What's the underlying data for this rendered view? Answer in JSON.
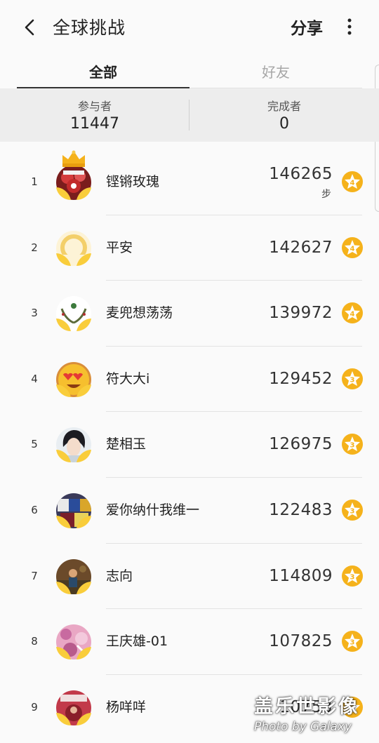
{
  "header": {
    "title": "全球挑战",
    "share_label": "分享"
  },
  "tabs": [
    {
      "label": "全部",
      "active": true
    },
    {
      "label": "好友",
      "active": false
    }
  ],
  "stats": {
    "participants_label": "参与者",
    "participants_value": "11447",
    "finishers_label": "完成者",
    "finishers_value": "0"
  },
  "ranking": [
    {
      "rank": "1",
      "name": "铿锵玫瑰",
      "steps": "146265",
      "unit": "步",
      "badge": "4",
      "avatar": "red-flowers",
      "crown": true
    },
    {
      "rank": "2",
      "name": "平安",
      "steps": "142627",
      "badge": "4",
      "avatar": "placeholder"
    },
    {
      "rank": "3",
      "name": "麦兜想荡荡",
      "steps": "139972",
      "badge": "4",
      "avatar": "wreath"
    },
    {
      "rank": "4",
      "name": "符大大i",
      "steps": "129452",
      "badge": "3",
      "avatar": "heart-eyes-emoji"
    },
    {
      "rank": "5",
      "name": "楚相玉",
      "steps": "126975",
      "badge": "3",
      "avatar": "anime-boy"
    },
    {
      "rank": "6",
      "name": "爱你纳什我维一",
      "steps": "122483",
      "badge": "3",
      "avatar": "jerseys"
    },
    {
      "rank": "7",
      "name": "志向",
      "steps": "114809",
      "badge": "3",
      "avatar": "brown-photo"
    },
    {
      "rank": "8",
      "name": "王庆雄-01",
      "steps": "107825",
      "badge": "3",
      "avatar": "pink-pattern"
    },
    {
      "rank": "9",
      "name": "杨咩咩",
      "steps": "10753",
      "badge": "3",
      "avatar": "red-photo"
    }
  ],
  "watermark": {
    "title": "盖乐世影像",
    "subtitle": "Photo by Galaxy"
  },
  "colors": {
    "badge": "#f5b21b",
    "leaves": "#f9cd3b",
    "stats_bg": "#ededed"
  }
}
